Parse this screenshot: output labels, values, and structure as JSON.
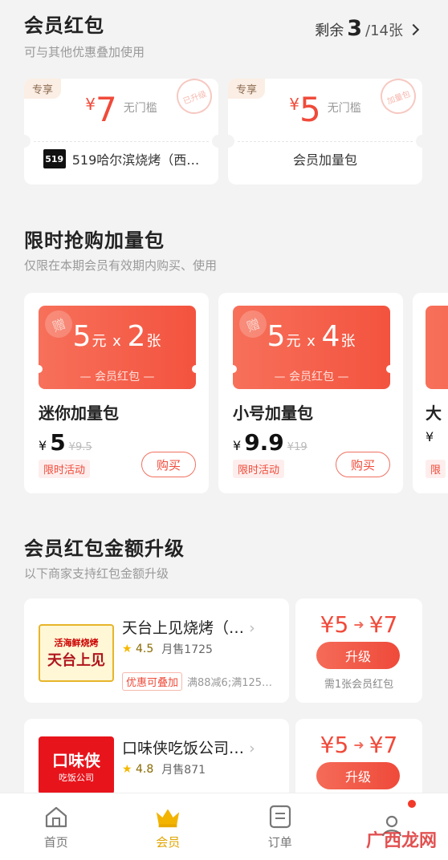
{
  "member_coupons": {
    "title": "会员红包",
    "subtitle": "可与其他优惠叠加使用",
    "remain_label": "剩余",
    "remain_count": "3",
    "remain_total": "/14张",
    "items": [
      {
        "tag": "专享",
        "yen": "¥",
        "amount": "7",
        "condition": "无门槛",
        "stamp": "已升级",
        "footer": "519哈尔滨烧烤（西…",
        "logo_text": "519"
      },
      {
        "tag": "专享",
        "yen": "¥",
        "amount": "5",
        "condition": "无门槛",
        "stamp": "加量包",
        "footer": "会员加量包"
      }
    ]
  },
  "flash_packs": {
    "title": "限时抢购加量包",
    "subtitle": "仅限在本期会员有效期内购买、使用",
    "items": [
      {
        "zeng": "赠",
        "value": "5",
        "unit": "元",
        "times": " x ",
        "count": "2",
        "count_unit": "张",
        "line": "— 会员红包 —",
        "name": "迷你加量包",
        "yen": "¥",
        "price": "5",
        "old_price": "¥9.5",
        "activity": "限时活动",
        "buy": "购买"
      },
      {
        "zeng": "赠",
        "value": "5",
        "unit": "元",
        "times": " x ",
        "count": "4",
        "count_unit": "张",
        "line": "— 会员红包 —",
        "name": "小号加量包",
        "yen": "¥",
        "price": "9.9",
        "old_price": "¥19",
        "activity": "限时活动",
        "buy": "购买"
      },
      {
        "name": "大",
        "yen": "¥",
        "activity": "限"
      }
    ]
  },
  "upgrade": {
    "title": "会员红包金额升级",
    "subtitle": "以下商家支持红包金额升级",
    "shops": [
      {
        "logo_l1": "活海鲜烧烤",
        "logo_l2": "天台上见",
        "name": "天台上见烧烤（…",
        "score": "4.5",
        "sales": "月售1725",
        "promo": "优惠可叠加",
        "discount": "满88减6;满125…",
        "from": "¥5",
        "to": "¥7",
        "button": "升级",
        "need": "需1张会员红包"
      },
      {
        "logo_l1": "口味侠",
        "logo_l2": "吃饭公司",
        "name": "口味侠吃饭公司…",
        "score": "4.8",
        "sales": "月售871",
        "from": "¥5",
        "to": "¥7",
        "button": "升级"
      }
    ]
  },
  "tabbar": [
    {
      "label": "首页",
      "icon": "home-icon"
    },
    {
      "label": "会员",
      "icon": "crown-icon",
      "active": true
    },
    {
      "label": "订单",
      "icon": "order-icon"
    },
    {
      "label": "",
      "icon": "profile-icon",
      "has_dot": true
    }
  ],
  "watermark": "广西龙网",
  "colors": {
    "accent": "#f04a3a",
    "active_tab": "#e0a400",
    "background": "#f3f3f3"
  }
}
